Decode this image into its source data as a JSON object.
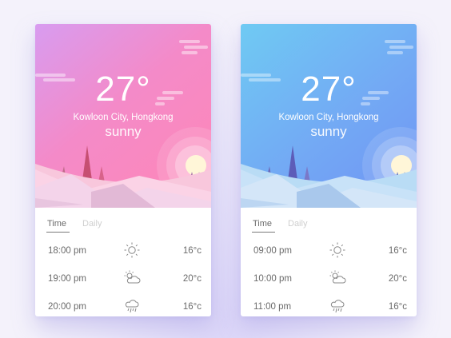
{
  "cards": [
    {
      "theme": "pink",
      "temperature": "27°",
      "location": "Kowloon City, Hongkong",
      "condition": "sunny",
      "tabs": [
        "Time",
        "Daily"
      ],
      "active_tab": "Time",
      "colors": {
        "gradient_start": "#d89cf0",
        "gradient_end": "#ff87b6"
      },
      "forecast": [
        {
          "time": "18:00 pm",
          "icon": "sun-icon",
          "temp": "16°c"
        },
        {
          "time": "19:00 pm",
          "icon": "partly-cloudy-icon",
          "temp": "20°c"
        },
        {
          "time": "20:00 pm",
          "icon": "rain-cloud-icon",
          "temp": "16°c"
        }
      ]
    },
    {
      "theme": "blue",
      "temperature": "27°",
      "location": "Kowloon City, Hongkong",
      "condition": "sunny",
      "tabs": [
        "Time",
        "Daily"
      ],
      "active_tab": "Time",
      "colors": {
        "gradient_start": "#6fcaf3",
        "gradient_end": "#6f93f4"
      },
      "forecast": [
        {
          "time": "09:00 pm",
          "icon": "sun-icon",
          "temp": "16°c"
        },
        {
          "time": "10:00 pm",
          "icon": "partly-cloudy-icon",
          "temp": "20°c"
        },
        {
          "time": "11:00 pm",
          "icon": "rain-cloud-icon",
          "temp": "16°c"
        }
      ]
    }
  ]
}
